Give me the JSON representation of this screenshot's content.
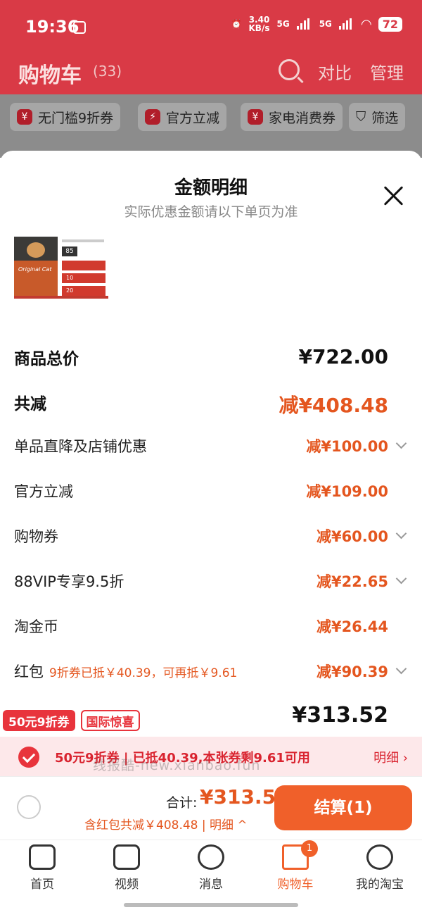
{
  "status": {
    "time": "19:36",
    "net_speed": "3.40",
    "net_unit": "KB/s",
    "sig1": "5G",
    "sig2": "5G",
    "battery": "72"
  },
  "nav": {
    "title": "购物车",
    "count": "(33)",
    "compare": "对比",
    "manage": "管理"
  },
  "chips": [
    {
      "label": "无门槛9折券"
    },
    {
      "label": "官方立减"
    },
    {
      "label": "家电消费券"
    },
    {
      "label": "筛选"
    }
  ],
  "sheet": {
    "title": "金额明细",
    "subtitle": "实际优惠金额请以下单页为准",
    "rows": [
      {
        "label": "商品总价",
        "value": "¥722.00"
      },
      {
        "label": "共减",
        "value": "减¥408.48"
      },
      {
        "label": "单品直降及店铺优惠",
        "value": "减¥100.00"
      },
      {
        "label": "官方立减",
        "value": "减¥109.00"
      },
      {
        "label": "购物券",
        "value": "减¥60.00"
      },
      {
        "label": "88VIP专享9.5折",
        "value": "减¥22.65"
      },
      {
        "label": "淘金币",
        "value": "减¥26.44"
      },
      {
        "label": "红包",
        "note": "9折券已抵￥40.39，可再抵￥9.61",
        "value": "减¥90.39"
      }
    ],
    "total_value": "¥313.52"
  },
  "promo": {
    "tag1": "50元9折券",
    "tag2": "国际惊喜"
  },
  "coupon": {
    "text": "50元9折券 | 已抵40.39,本张券剩9.61可用",
    "detail": "明细 ›"
  },
  "watermark": "线报酷-new.xianbao.fun",
  "checkout": {
    "sum_label": "合计:",
    "sum_value": "¥313.52",
    "detail": "含红包共减￥408.48 | 明细 ^",
    "button": "结算(1)"
  },
  "tabs": [
    {
      "label": "首页"
    },
    {
      "label": "视频"
    },
    {
      "label": "消息"
    },
    {
      "label": "购物车",
      "badge": "1"
    },
    {
      "label": "我的淘宝"
    }
  ],
  "colors": {
    "accent": "#f0602a",
    "brand_red": "#e8343c",
    "discount": "#e4561f"
  }
}
